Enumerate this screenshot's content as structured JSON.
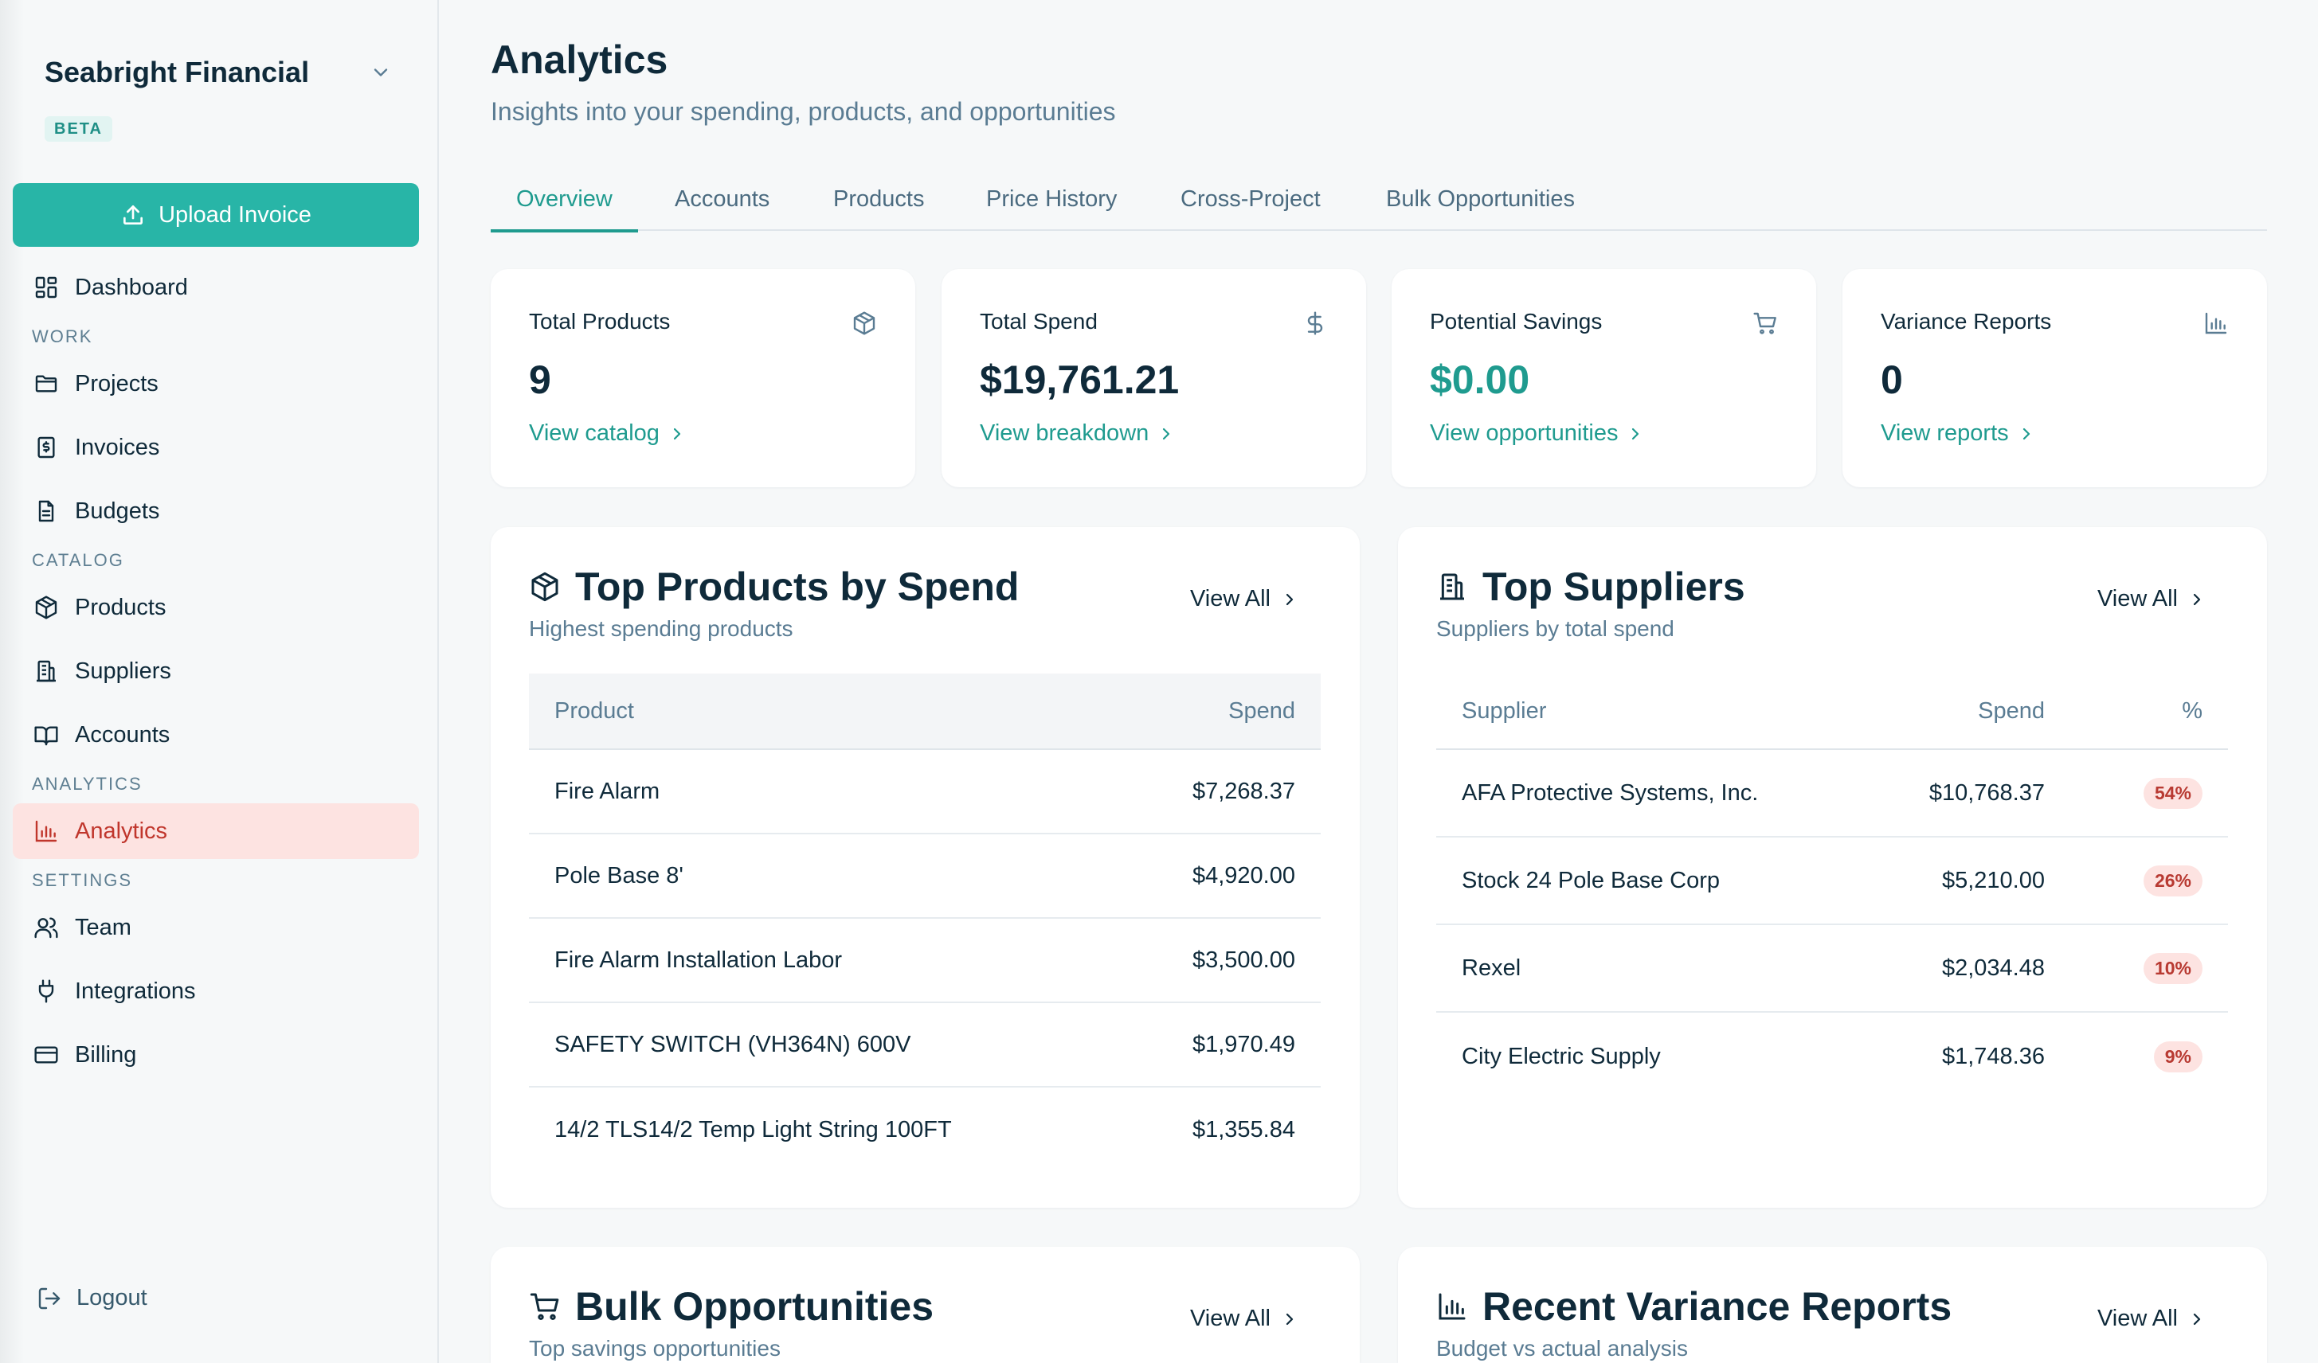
{
  "sidebar": {
    "org_name": "Seabright Financial",
    "beta_label": "BETA",
    "upload_label": "Upload Invoice",
    "dashboard": "Dashboard",
    "sections": {
      "work": "WORK",
      "catalog": "CATALOG",
      "analytics": "ANALYTICS",
      "settings": "SETTINGS"
    },
    "items": {
      "projects": "Projects",
      "invoices": "Invoices",
      "budgets": "Budgets",
      "products": "Products",
      "suppliers": "Suppliers",
      "accounts": "Accounts",
      "analytics": "Analytics",
      "team": "Team",
      "integrations": "Integrations",
      "billing": "Billing"
    },
    "logout": "Logout"
  },
  "page": {
    "title": "Analytics",
    "subtitle": "Insights into your spending, products, and opportunities"
  },
  "tabs": [
    "Overview",
    "Accounts",
    "Products",
    "Price History",
    "Cross-Project",
    "Bulk Opportunities"
  ],
  "stats": [
    {
      "title": "Total Products",
      "value": "9",
      "link": "View catalog",
      "icon": "box-icon"
    },
    {
      "title": "Total Spend",
      "value": "$19,761.21",
      "link": "View breakdown",
      "icon": "dollar-icon"
    },
    {
      "title": "Potential Savings",
      "value": "$0.00",
      "link": "View opportunities",
      "icon": "cart-icon"
    },
    {
      "title": "Variance Reports",
      "value": "0",
      "link": "View reports",
      "icon": "bar-chart-icon"
    }
  ],
  "top_products": {
    "title": "Top Products by Spend",
    "subtitle": "Highest spending products",
    "view_all": "View All",
    "headers": {
      "product": "Product",
      "spend": "Spend"
    },
    "rows": [
      {
        "name": "Fire Alarm",
        "spend": "$7,268.37"
      },
      {
        "name": "Pole Base 8'",
        "spend": "$4,920.00"
      },
      {
        "name": "Fire Alarm Installation Labor",
        "spend": "$3,500.00"
      },
      {
        "name": "SAFETY SWITCH (VH364N) 600V",
        "spend": "$1,970.49"
      },
      {
        "name": "14/2 TLS14/2 Temp Light String 100FT",
        "spend": "$1,355.84"
      }
    ]
  },
  "top_suppliers": {
    "title": "Top Suppliers",
    "subtitle": "Suppliers by total spend",
    "view_all": "View All",
    "headers": {
      "supplier": "Supplier",
      "spend": "Spend",
      "pct": "%"
    },
    "rows": [
      {
        "name": "AFA Protective Systems, Inc.",
        "spend": "$10,768.37",
        "pct": "54%"
      },
      {
        "name": "Stock 24 Pole Base Corp",
        "spend": "$5,210.00",
        "pct": "26%"
      },
      {
        "name": "Rexel",
        "spend": "$2,034.48",
        "pct": "10%"
      },
      {
        "name": "City Electric Supply",
        "spend": "$1,748.36",
        "pct": "9%"
      }
    ]
  },
  "bulk": {
    "title": "Bulk Opportunities",
    "subtitle": "Top savings opportunities",
    "view_all": "View All"
  },
  "variance": {
    "title": "Recent Variance Reports",
    "subtitle": "Budget vs actual analysis",
    "view_all": "View All"
  },
  "colors": {
    "accent": "#28b5a7",
    "accent_text": "#1f9b8f",
    "active_nav_bg": "#fde3e1",
    "active_nav_text": "#c0362c"
  }
}
